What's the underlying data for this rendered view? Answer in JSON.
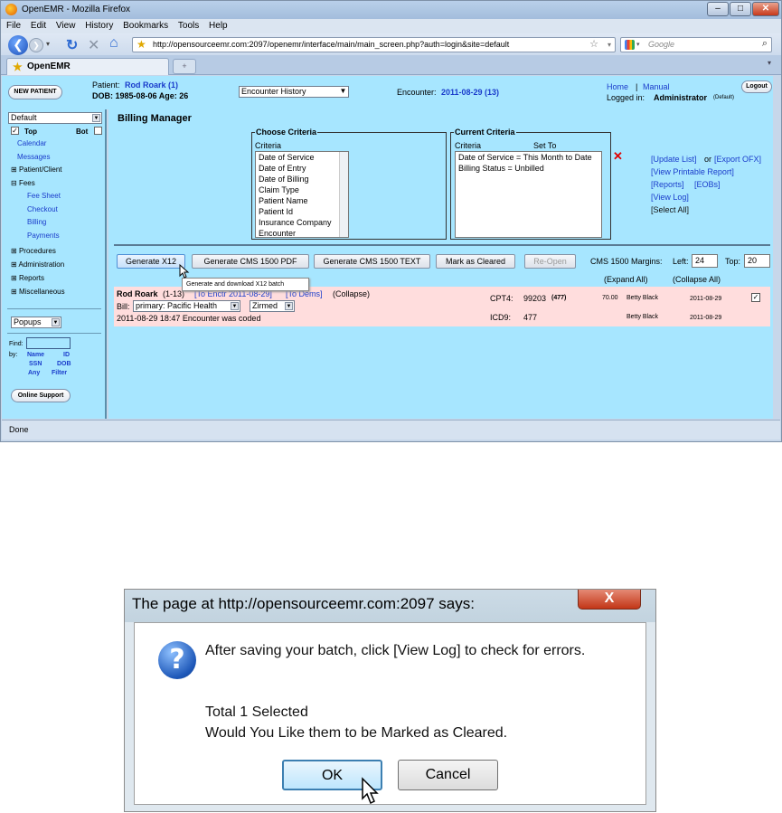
{
  "browser": {
    "title": "OpenEMR - Mozilla Firefox",
    "menu": [
      "File",
      "Edit",
      "View",
      "History",
      "Bookmarks",
      "Tools",
      "Help"
    ],
    "url": "http://opensourceemr.com:2097/openemr/interface/main/main_screen.php?auth=login&site=default",
    "search_placeholder": "Google",
    "tab_label": "OpenEMR",
    "status": "Done"
  },
  "header": {
    "new_patient": "NEW PATIENT",
    "patient_label": "Patient:",
    "patient_name": "Rod Roark (1)",
    "dob_line": "DOB: 1985-08-06 Age: 26",
    "encounter_select": "Encounter History",
    "encounter_label": "Encounter:",
    "encounter_value": "2011-08-29 (13)",
    "home": "Home",
    "sep": "|",
    "manual": "Manual",
    "logged_in_label": "Logged in:",
    "user": "Administrator",
    "user_suffix": "(Default)",
    "logout": "Logout"
  },
  "leftnav": {
    "frame_select": "Default",
    "top_label": "Top",
    "bot_label": "Bot",
    "items": [
      "Calendar",
      "Messages",
      "Patient/Client",
      "Fees",
      "Fee Sheet",
      "Checkout",
      "Billing",
      "Payments",
      "Procedures",
      "Administration",
      "Reports",
      "Miscellaneous"
    ],
    "popups": "Popups",
    "find_label": "Find:",
    "by_label": "by:",
    "by_links": [
      "Name",
      "ID",
      "SSN",
      "DOB",
      "Any",
      "Filter"
    ],
    "online_support": "Online Support"
  },
  "main": {
    "title": "Billing Manager",
    "choose_legend": "Choose Criteria",
    "choose_header": "Criteria",
    "choose_items": [
      "Date of Service",
      "Date of Entry",
      "Date of Billing",
      "Claim Type",
      "Patient Name",
      "Patient Id",
      "Insurance Company",
      "Encounter"
    ],
    "current_legend": "Current Criteria",
    "current_col1": "Criteria",
    "current_col2": "Set To",
    "current_items": [
      "Date of Service = This Month to Date",
      "Billing Status = Unbilled"
    ],
    "links": [
      "[Update List]",
      "or",
      "[Export OFX]",
      "[View Printable Report]",
      "[Reports]",
      "[EOBs]",
      "[View Log]",
      "[Select All]"
    ],
    "buttons": [
      "Generate X12",
      "Generate CMS 1500 PDF",
      "Generate CMS 1500 TEXT",
      "Mark as Cleared",
      "Re-Open"
    ],
    "margins_label": "CMS 1500 Margins:",
    "left_label": "Left:",
    "left_value": "24",
    "top_label": "Top:",
    "top_value": "20",
    "expand_all": "(Expand All)",
    "collapse_all": "(Collapse All)",
    "tooltip": "Generate and download X12 batch",
    "record": {
      "name": "Rod Roark",
      "id": "(1-13)",
      "to_encounter": "[To Enctr 2011-08-29]",
      "to_dems": "[To Dems]",
      "collapse": "(Collapse)",
      "bill_label": "Bill:",
      "bill_select": "primary: Pacific Health",
      "partner_select": "Zirmed",
      "log_line": "2011-08-29 18:47 Encounter was coded",
      "lines": [
        {
          "type": "CPT4:",
          "code": "99203",
          "mod": "(477)",
          "fee": "70.00",
          "provider": "Betty Black",
          "date": "2011-08-29",
          "checked": true
        },
        {
          "type": "ICD9:",
          "code": "477",
          "mod": "",
          "fee": "",
          "provider": "Betty Black",
          "date": "2011-08-29",
          "checked": false
        }
      ]
    }
  },
  "dialog": {
    "title": "The page at http://opensourceemr.com:2097 says:",
    "close": "X",
    "line1": "After saving your batch, click [View Log] to check for errors.",
    "line2": "Total 1 Selected",
    "line3": "Would You Like them to be Marked as Cleared.",
    "ok": "OK",
    "cancel": "Cancel"
  }
}
